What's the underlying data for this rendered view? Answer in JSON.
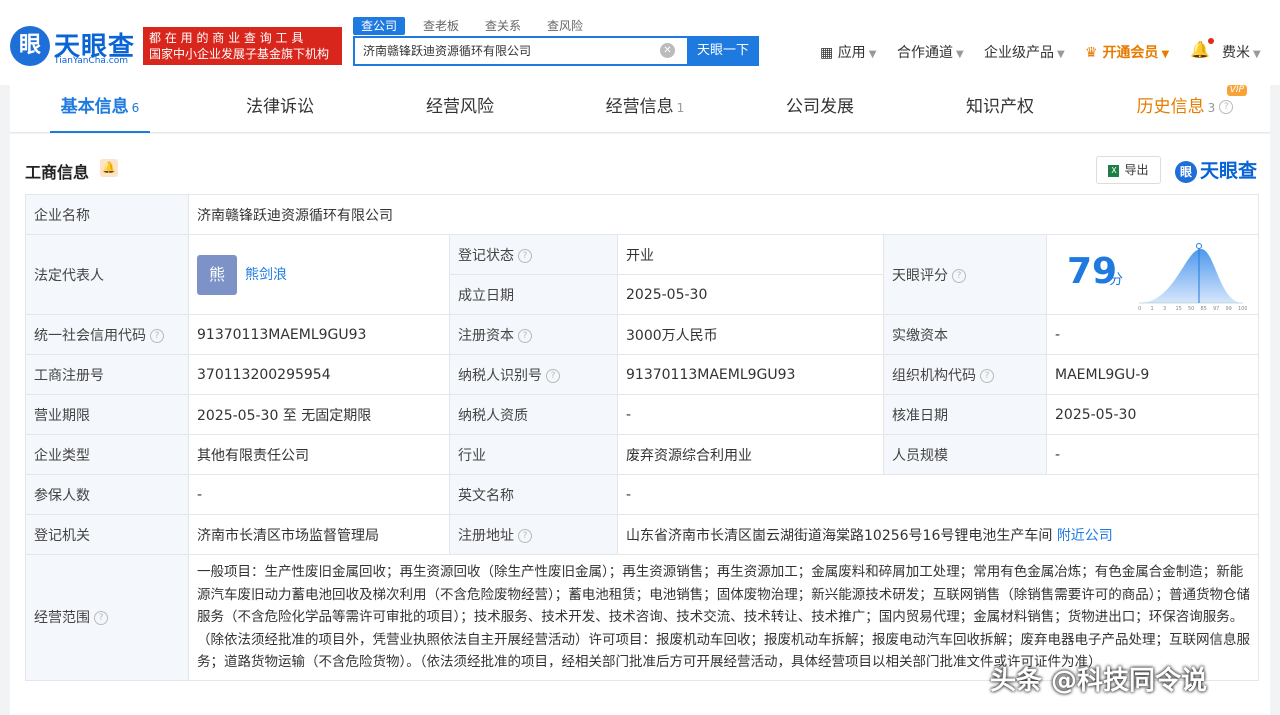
{
  "logo": {
    "mark": "Ⓡ",
    "name_cn": "天眼查",
    "name_en": "TianYanCha.com"
  },
  "promo": {
    "line1": "都 在 用 的 商 业 查 询 工 具",
    "line2": "国家中小企业发展子基金旗下机构"
  },
  "search": {
    "tabs": [
      "查公司",
      "查老板",
      "查关系",
      "查风险"
    ],
    "value": "济南赣锋跃迪资源循环有限公司",
    "button": "天眼一下"
  },
  "nav": {
    "apps": "应用",
    "cooperation": "合作通道",
    "enterprise": "企业级产品",
    "vip": "开通会员",
    "user": "费米"
  },
  "tabs": [
    {
      "label": "基本信息",
      "count": "6"
    },
    {
      "label": "法律诉讼",
      "count": ""
    },
    {
      "label": "经营风险",
      "count": ""
    },
    {
      "label": "经营信息",
      "count": "1"
    },
    {
      "label": "公司发展",
      "count": ""
    },
    {
      "label": "知识产权",
      "count": ""
    },
    {
      "label": "历史信息",
      "count": "3",
      "badge": "VIP"
    }
  ],
  "section": {
    "title": "工商信息",
    "export": "导出",
    "watermark_logo": "天眼查"
  },
  "info": {
    "company_name_label": "企业名称",
    "company_name": "济南赣锋跃迪资源循环有限公司",
    "legal_rep_label": "法定代表人",
    "legal_rep_avatar": "熊",
    "legal_rep": "熊剑浪",
    "reg_status_label": "登记状态",
    "reg_status": "开业",
    "founded_label": "成立日期",
    "founded": "2025-05-30",
    "tianyan_score_label": "天眼评分",
    "tianyan_score": "79",
    "score_unit": "分",
    "score_axis": [
      "0",
      "1",
      "3",
      "15",
      "50",
      "85",
      "97",
      "99",
      "100"
    ],
    "credit_code_label": "统一社会信用代码",
    "credit_code": "91370113MAEML9GU93",
    "reg_capital_label": "注册资本",
    "reg_capital": "3000万人民币",
    "paid_capital_label": "实缴资本",
    "paid_capital": "-",
    "reg_no_label": "工商注册号",
    "reg_no": "370113200295954",
    "taxpayer_id_label": "纳税人识别号",
    "taxpayer_id": "91370113MAEML9GU93",
    "org_code_label": "组织机构代码",
    "org_code": "MAEML9GU-9",
    "term_label": "营业期限",
    "term": "2025-05-30 至 无固定期限",
    "taxpayer_qual_label": "纳税人资质",
    "taxpayer_qual": "-",
    "approval_date_label": "核准日期",
    "approval_date": "2025-05-30",
    "type_label": "企业类型",
    "type": "其他有限责任公司",
    "industry_label": "行业",
    "industry": "废弃资源综合利用业",
    "staff_label": "人员规模",
    "staff": "-",
    "insured_label": "参保人数",
    "insured": "-",
    "english_name_label": "英文名称",
    "english_name": "-",
    "authority_label": "登记机关",
    "authority": "济南市长清区市场监督管理局",
    "address_label": "注册地址",
    "address": "山东省济南市长清区崮云湖街道海棠路10256号16号锂电池生产车间",
    "nearby": "附近公司",
    "scope_label": "经营范围",
    "scope": "一般项目：生产性废旧金属回收；再生资源回收（除生产性废旧金属）；再生资源销售；再生资源加工；金属废料和碎屑加工处理；常用有色金属冶炼；有色金属合金制造；新能源汽车废旧动力蓄电池回收及梯次利用（不含危险废物经营）；蓄电池租赁；电池销售；固体废物治理；新兴能源技术研发；互联网销售（除销售需要许可的商品）；普通货物仓储服务（不含危险化学品等需许可审批的项目）；技术服务、技术开发、技术咨询、技术交流、技术转让、技术推广；国内贸易代理；金属材料销售；货物进出口；环保咨询服务。（除依法须经批准的项目外，凭营业执照依法自主开展经营活动）许可项目：报废机动车回收；报废机动车拆解；报废电动汽车回收拆解；废弃电器电子产品处理；互联网信息服务；道路货物运输（不含危险货物）。（依法须经批准的项目，经相关部门批准后方可开展经营活动，具体经营项目以相关部门批准文件或许可证件为准）"
  },
  "watermark": "头条 @科技同令说",
  "colors": {
    "accent": "#1f7ae0",
    "promo": "#d9261c",
    "status_green": "#0a8c3c",
    "vip_orange": "#e77b00"
  }
}
